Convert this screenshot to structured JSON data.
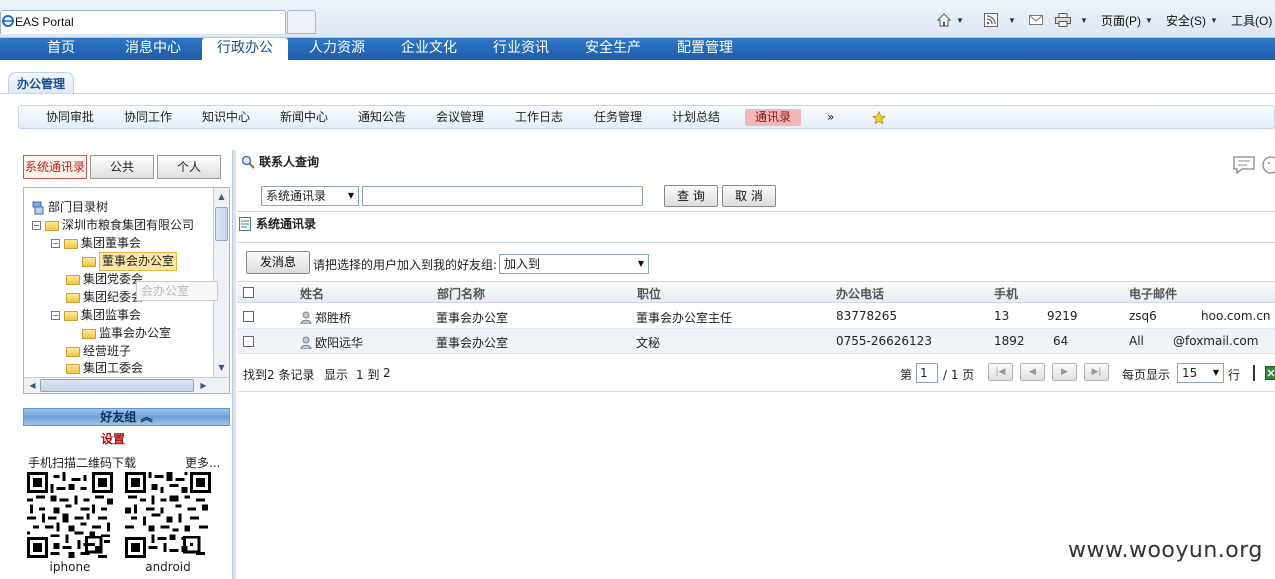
{
  "browser": {
    "tab_title": "EAS Portal",
    "page_menu": "页面(P)",
    "safety_menu": "安全(S)",
    "tools_menu": "工具(O)"
  },
  "main_nav": [
    {
      "label": "首页"
    },
    {
      "label": "消息中心"
    },
    {
      "label": "行政办公",
      "active": true
    },
    {
      "label": "人力资源"
    },
    {
      "label": "企业文化"
    },
    {
      "label": "行业资讯"
    },
    {
      "label": "安全生产"
    },
    {
      "label": "配置管理"
    }
  ],
  "office": {
    "title": "办公管理"
  },
  "sub_nav": [
    {
      "label": "协同审批"
    },
    {
      "label": "协同工作"
    },
    {
      "label": "知识中心"
    },
    {
      "label": "新闻中心"
    },
    {
      "label": "通知公告"
    },
    {
      "label": "会议管理"
    },
    {
      "label": "工作日志"
    },
    {
      "label": "任务管理"
    },
    {
      "label": "计划总结"
    },
    {
      "label": "通讯录",
      "active": true
    },
    {
      "label": "»"
    }
  ],
  "left": {
    "tabs": [
      "系统通讯录",
      "公共",
      "个人"
    ],
    "tree": [
      {
        "label": "部门目录树"
      },
      {
        "label": "深圳市粮食集团有限公司"
      },
      {
        "label": "集团董事会"
      },
      {
        "label": "董事会办公室"
      },
      {
        "label": "集团党委会"
      },
      {
        "label": "集团纪委会"
      },
      {
        "label": "集团监事会"
      },
      {
        "label": "监事会办公室"
      },
      {
        "label": "经营班子"
      },
      {
        "label": "集团工委会"
      }
    ],
    "tooltip_ghost": "会办公室",
    "friend_group": "好友组 ︽",
    "settings": "设置",
    "qr_label": "手机扫描二维码下载",
    "more": "更多...",
    "qr_iphone": "iphone",
    "qr_android": "android"
  },
  "content": {
    "query_title": "联系人查询",
    "source_select": "系统通讯录",
    "search_value": "",
    "query_button": "查 询",
    "cancel_button": "取 消",
    "list_title": "系统通讯录",
    "send_button": "发消息",
    "add_prompt": "请把选择的用户加入到我的好友组:",
    "add_select": "加入到",
    "columns": [
      "姓名",
      "部门名称",
      "职位",
      "办公电话",
      "手机",
      "电子邮件"
    ],
    "rows": [
      {
        "name": "郑胜桥",
        "dept": "董事会办公室",
        "position": "董事会办公室主任",
        "office_phone": "83778265",
        "mobile_prefix": "13",
        "mobile_suffix": "9219",
        "email_prefix": "zsq6",
        "email_suffix": "hoo.com.cn"
      },
      {
        "name": "欧阳远华",
        "dept": "董事会办公室",
        "position": "文秘",
        "office_phone": "0755-26626123",
        "mobile_prefix": "1892",
        "mobile_suffix": "64",
        "email_prefix": "All",
        "email_suffix": "@foxmail.com"
      }
    ],
    "footer": {
      "found": "找到2 条记录",
      "display": "显示",
      "range": "1 到",
      "range_end": "2",
      "page_prefix": "第",
      "page_current": "1",
      "page_total": "/ 1 页",
      "per_page_label": "每页显示",
      "per_page_value": "15",
      "per_page_unit": "行"
    }
  },
  "watermark": "www.wooyun.org"
}
